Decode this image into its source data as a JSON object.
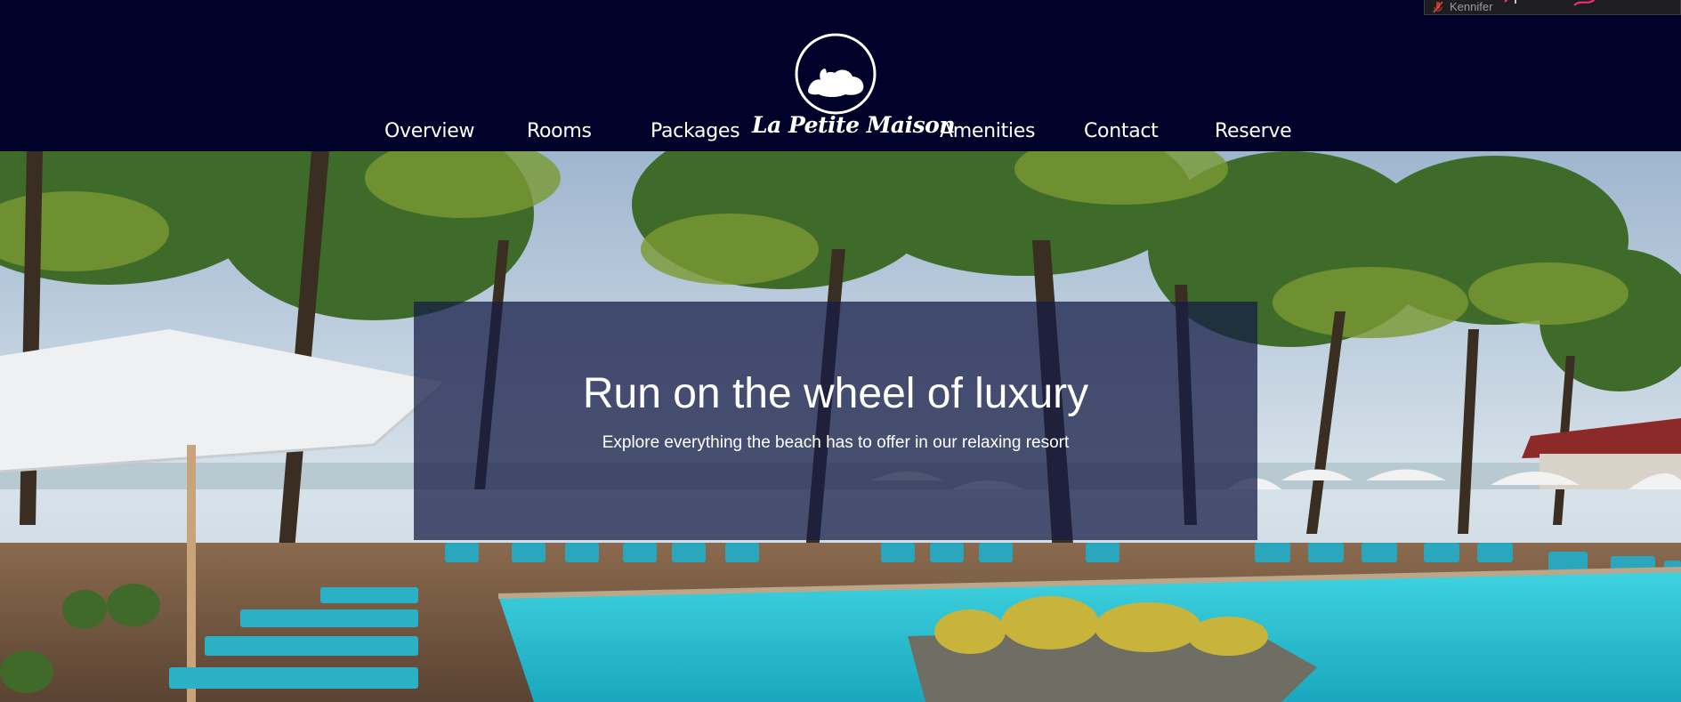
{
  "brand": {
    "name": "La Petite Maison",
    "logo_icon": "sleeping-dog-icon"
  },
  "nav": {
    "items": [
      "Overview",
      "Rooms",
      "Packages",
      "Amenities",
      "Contact",
      "Reserve"
    ]
  },
  "user": {
    "name": "Kennifer",
    "icon": "mic-muted-icon"
  },
  "hero": {
    "title": "Run on the wheel of luxury",
    "subtitle": "Explore everything the beach has to offer in our relaxing resort",
    "image": "resort-pool-with-palm-trees"
  },
  "colors": {
    "header_bg": "#01022a",
    "overlay_bg": "#161c46",
    "pool": "#2ec4d6",
    "text": "#ffffff"
  }
}
